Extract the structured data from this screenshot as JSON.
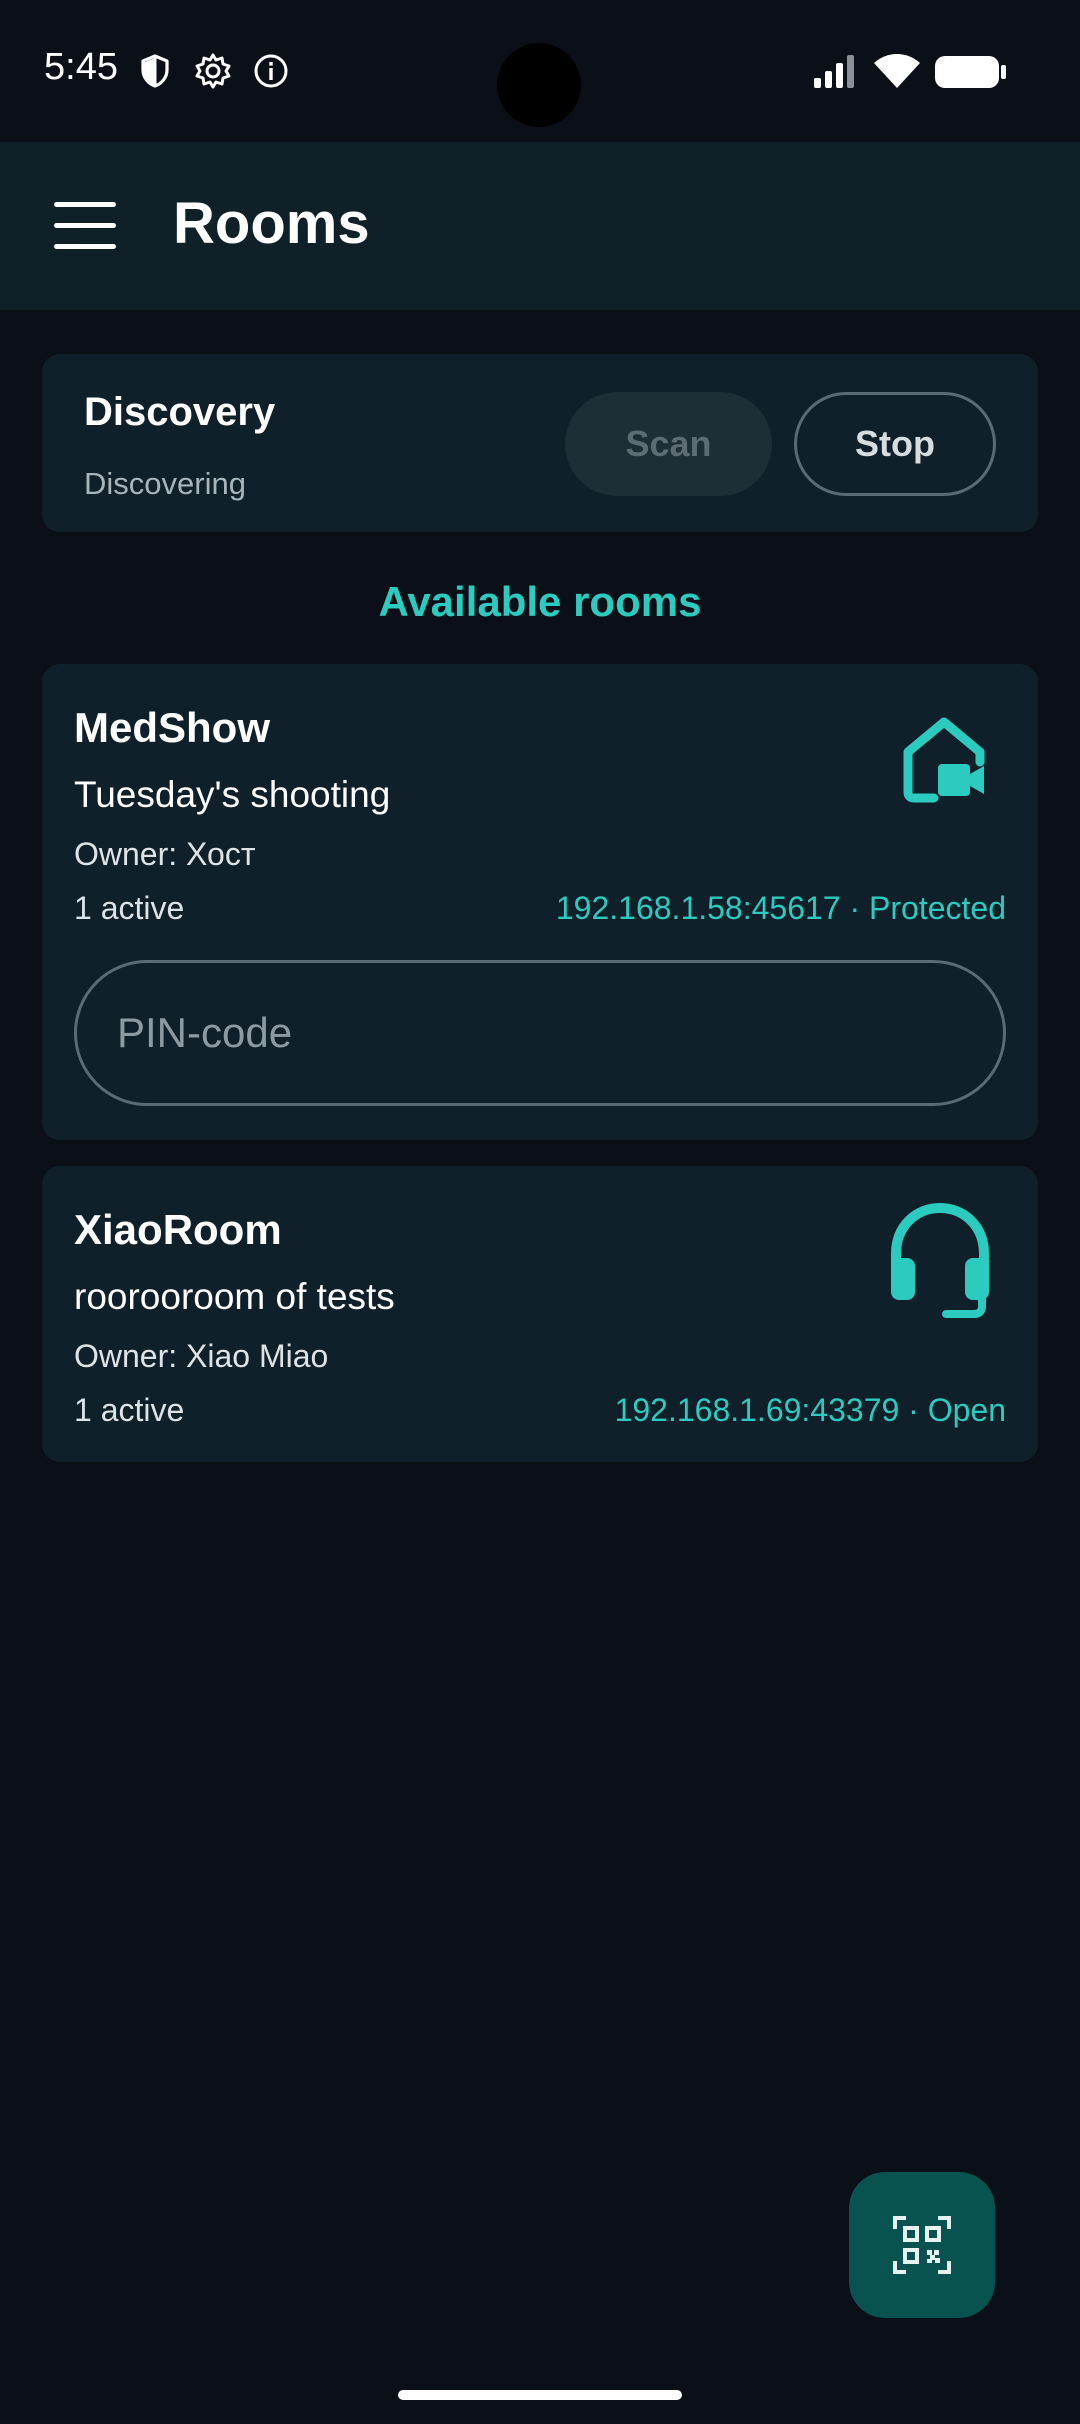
{
  "status_bar": {
    "time": "5:45",
    "icons": [
      "shield-icon",
      "gear-icon",
      "info-icon",
      "signal-icon",
      "wifi-icon",
      "battery-icon"
    ]
  },
  "app_bar": {
    "menu_icon": "hamburger-menu-icon",
    "title": "Rooms"
  },
  "discovery": {
    "title": "Discovery",
    "status": "Discovering",
    "scan_label": "Scan",
    "stop_label": "Stop"
  },
  "section_title": "Available rooms",
  "rooms": [
    {
      "name": "MedShow",
      "description": "Tuesday's shooting",
      "owner": "Owner: Хост",
      "active": "1 active",
      "address": "192.168.1.58:45617 · Protected",
      "icon": "home-video-icon",
      "pin_placeholder": "PIN-code"
    },
    {
      "name": "XiaoRoom",
      "description": "roorooroom of tests",
      "owner": "Owner: Xiao Miao",
      "active": "1 active",
      "address": "192.168.1.69:43379 · Open",
      "icon": "headset-icon"
    }
  ],
  "fab": {
    "icon": "qr-scan-icon"
  },
  "colors": {
    "background": "#0a0f18",
    "app_bar": "#0f2028",
    "card": "#10202a",
    "accent": "#2ccbbf",
    "fab": "#08534f"
  }
}
